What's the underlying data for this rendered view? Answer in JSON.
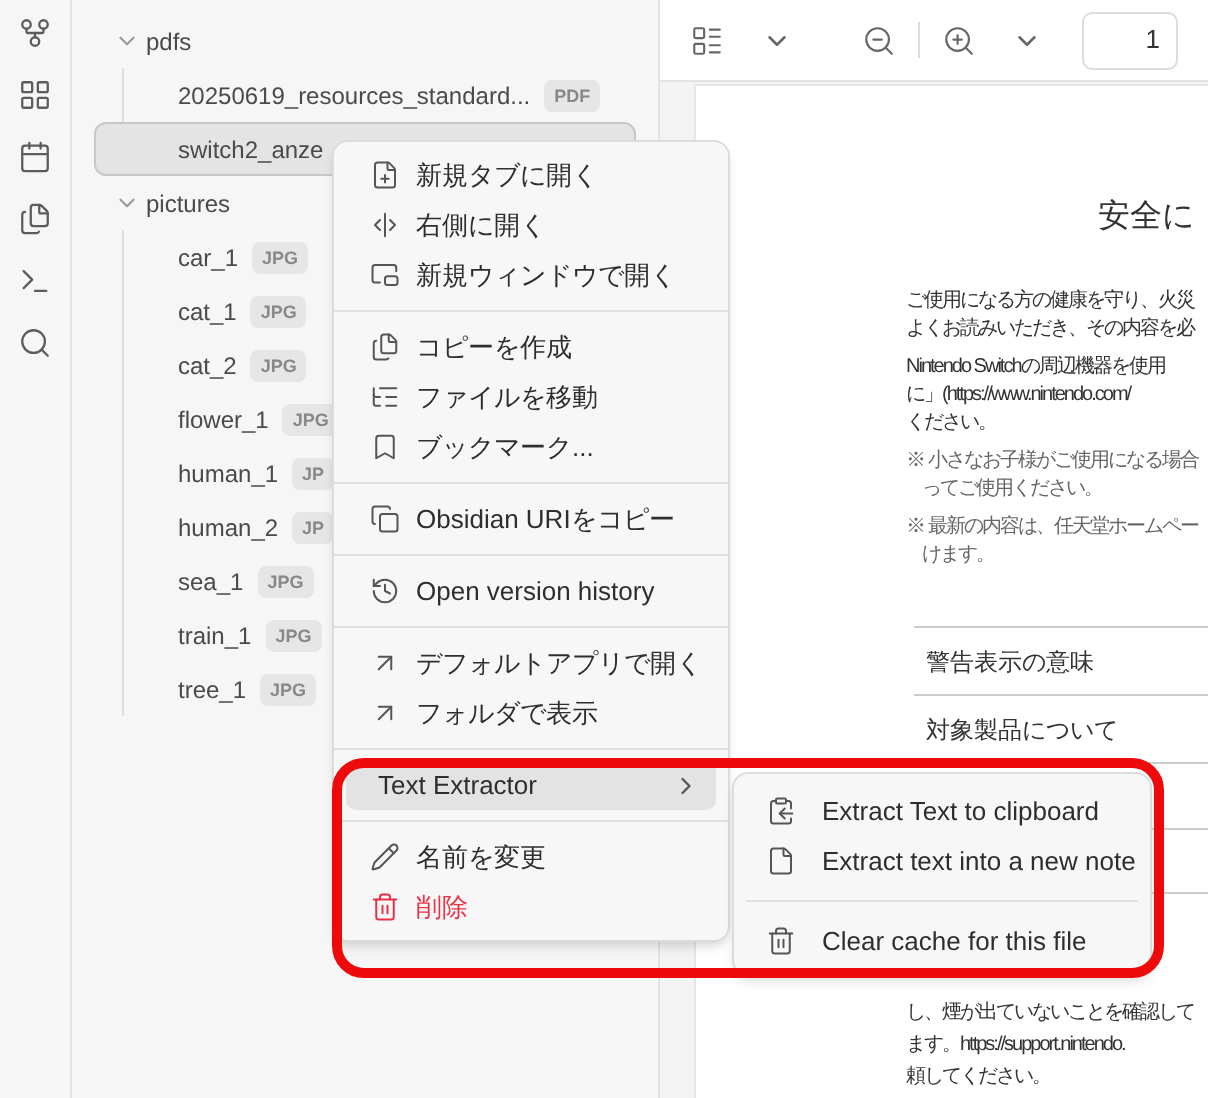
{
  "file_tree": [
    {
      "name": "pdfs",
      "kind": "folder",
      "expanded": true,
      "children": [
        {
          "name": "20250619_resources_standard...",
          "badge": "PDF",
          "selected": false
        },
        {
          "name": "switch2_anze",
          "selected": true
        }
      ]
    },
    {
      "name": "pictures",
      "kind": "folder",
      "expanded": true,
      "children": [
        {
          "name": "car_1",
          "badge": "JPG",
          "selected": false
        },
        {
          "name": "cat_1",
          "badge": "JPG",
          "selected": false
        },
        {
          "name": "cat_2",
          "badge": "JPG",
          "selected": false
        },
        {
          "name": "flower_1",
          "badge": "JPG",
          "selected": false
        },
        {
          "name": "human_1",
          "badge": "JP",
          "selected": false
        },
        {
          "name": "human_2",
          "badge": "JP",
          "selected": false
        },
        {
          "name": "sea_1",
          "badge": "JPG",
          "selected": false
        },
        {
          "name": "train_1",
          "badge": "JPG",
          "selected": false
        },
        {
          "name": "tree_1",
          "badge": "JPG",
          "selected": false
        }
      ]
    }
  ],
  "toolbar": {
    "page_number": "1"
  },
  "document": {
    "heading": "安全に",
    "paragraphs": [
      [
        "ご使用になる方の健康を守り、火災",
        "よくお読みいただき、その内容を必"
      ],
      [
        "Nintendo Switchの周辺機器を使用",
        "に」(https://www.nintendo.com/",
        "ください。"
      ]
    ],
    "notes": [
      [
        "※ 小さなお子様がご使用になる場合",
        "ってご使用ください。"
      ],
      [
        "※ 最新の内容は、任天堂ホームペー",
        "けます。"
      ]
    ],
    "sections": [
      "警告表示の意味",
      "対象製品について"
    ],
    "footer_lines": [
      "し、煙が出ていないことを確認して",
      "ます。https://support.nintendo.",
      "頼してください。"
    ]
  },
  "context_menu": {
    "groups": [
      [
        {
          "label": "新規タブに開く",
          "kind": "item",
          "selected": false
        },
        {
          "label": "右側に開く",
          "kind": "item",
          "selected": false
        },
        {
          "label": "新規ウィンドウで開く",
          "kind": "item",
          "selected": false
        }
      ],
      [
        {
          "label": "コピーを作成",
          "kind": "item",
          "selected": false
        },
        {
          "label": "ファイルを移動",
          "kind": "item",
          "selected": false
        },
        {
          "label": "ブックマーク...",
          "kind": "item",
          "selected": false
        }
      ],
      [
        {
          "label": "Obsidian URIをコピー",
          "kind": "item",
          "selected": false
        }
      ],
      [
        {
          "label": "Open version history",
          "kind": "item",
          "selected": false
        }
      ],
      [
        {
          "label": "デフォルトアプリで開く",
          "kind": "item",
          "selected": false
        },
        {
          "label": "フォルダで表示",
          "kind": "item",
          "selected": false
        }
      ],
      [
        {
          "label": "Text Extractor",
          "kind": "submenu",
          "selected": true
        }
      ],
      [
        {
          "label": "名前を変更",
          "kind": "item",
          "selected": false
        },
        {
          "label": "削除",
          "kind": "danger",
          "selected": false
        }
      ]
    ]
  },
  "submenu": {
    "groups": [
      [
        {
          "label": "Extract Text to clipboard"
        },
        {
          "label": "Extract text into a new note"
        }
      ],
      [
        {
          "label": "Clear cache for this file"
        }
      ]
    ]
  }
}
